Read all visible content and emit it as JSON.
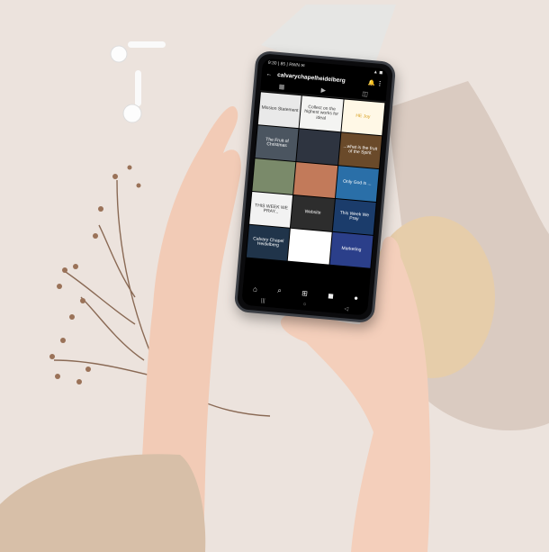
{
  "phone": {
    "status_time": "9:30 | 85 | RWN ✉",
    "status_icons": "▲ ◼",
    "back_icon": "←",
    "username": "calvarychapelheidelberg",
    "header_icons": "🔔 ⋮",
    "tabs": [
      "▦",
      "▶",
      "◫"
    ],
    "tiles": [
      {
        "bg": "#e9e9e9",
        "fg": "#333",
        "text": "Mission Statement"
      },
      {
        "bg": "#f4f4f2",
        "fg": "#3a3a3a",
        "text": "Collect on the highest works for ideal"
      },
      {
        "bg": "#fff8e6",
        "fg": "#d8a020",
        "text": "HE Joy"
      },
      {
        "bg": "#4b5560",
        "fg": "#fff",
        "text": "The Fruit of Christmas"
      },
      {
        "bg": "#2e3440",
        "fg": "#f2d060",
        "text": ""
      },
      {
        "bg": "#6a4a2a",
        "fg": "#fff",
        "text": "...what is the fruit of the Spirit"
      },
      {
        "bg": "#7a8a6a",
        "fg": "#fff",
        "text": ""
      },
      {
        "bg": "#c27a5a",
        "fg": "#fff",
        "text": ""
      },
      {
        "bg": "#2a6fa8",
        "fg": "#fff",
        "text": "Only God is ..."
      },
      {
        "bg": "#f2f2f2",
        "fg": "#333",
        "text": "THIS WEEK WE PRAY..."
      },
      {
        "bg": "#2d2d2d",
        "fg": "#fff",
        "text": "Website"
      },
      {
        "bg": "#1b3c6b",
        "fg": "#fff",
        "text": "This Week We Pray"
      },
      {
        "bg": "#20344a",
        "fg": "#fff",
        "text": "Calvary Chapel Heidelberg"
      },
      {
        "bg": "#ffffff",
        "fg": "#333",
        "text": ""
      },
      {
        "bg": "#2b3f8a",
        "fg": "#fff",
        "text": "Marketing"
      }
    ],
    "nav_icons": [
      "⌂",
      "⌕",
      "⊞",
      "◼",
      "●"
    ],
    "sys_icons": [
      "|||",
      "○",
      "◁"
    ]
  },
  "colors": {
    "background": "#ece3dd",
    "shadow_shape": "#d8c9bf",
    "sun_shape": "#e3c9a4",
    "skin": "#f3cdb9",
    "sleeve": "#d6bfa7"
  }
}
